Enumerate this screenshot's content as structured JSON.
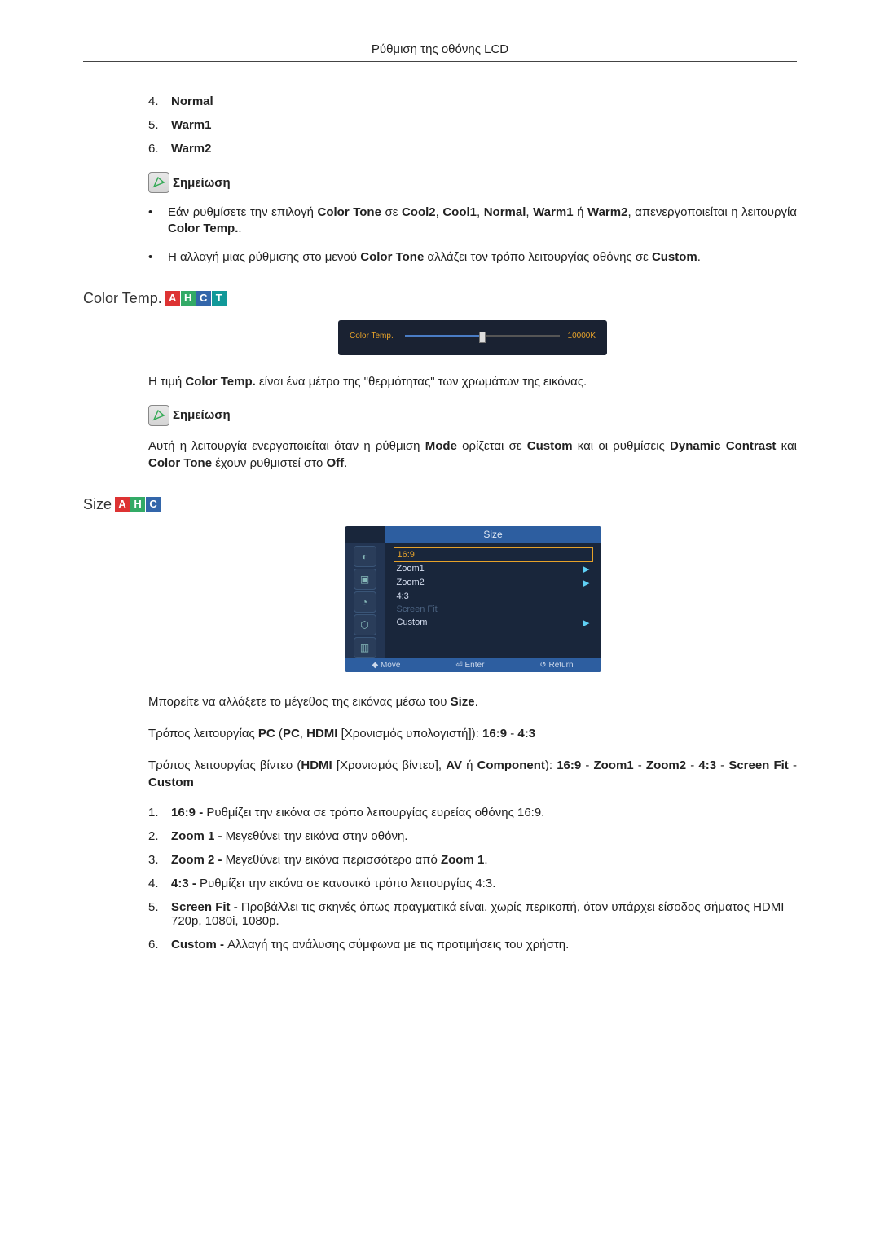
{
  "header": {
    "title": "Ρύθμιση της οθόνης LCD"
  },
  "top_list": {
    "items": [
      {
        "num": "4.",
        "label": "Normal"
      },
      {
        "num": "5.",
        "label": "Warm1"
      },
      {
        "num": "6.",
        "label": "Warm2"
      }
    ]
  },
  "note_label": "Σημείωση",
  "note1": {
    "bullets": [
      "Εάν ρυθμίσετε την επιλογή Color Tone σε Cool2, Cool1, Normal, Warm1 ή Warm2, απενεργοποιείται η λειτουργία Color Temp..",
      "Η αλλαγή μιας ρύθμισης στο μενού Color Tone αλλάζει τον τρόπο λειτουργίας οθόνης σε Custom."
    ]
  },
  "color_temp": {
    "title": "Color Temp.",
    "slider_label": "Color Temp.",
    "slider_value": "10000K",
    "para": "Η τιμή Color Temp. είναι ένα μέτρο της \"θερμότητας\" των χρωμάτων της εικόνας.",
    "note_body": "Αυτή η λειτουργία ενεργοποιείται όταν η ρύθμιση Mode ορίζεται σε Custom και οι ρυθμίσεις Dynamic Contrast και Color Tone έχουν ρυθμιστεί στο Off."
  },
  "size": {
    "title": "Size",
    "menu_title": "Size",
    "menu_items": [
      {
        "label": "16:9",
        "selected": true
      },
      {
        "label": "Zoom1",
        "arrow": true
      },
      {
        "label": "Zoom2",
        "arrow": true
      },
      {
        "label": "4:3"
      },
      {
        "label": "Screen Fit",
        "disabled": true
      },
      {
        "label": "Custom",
        "arrow": true
      }
    ],
    "footer": {
      "move": "Move",
      "enter": "Enter",
      "return": "Return"
    },
    "para1": "Μπορείτε να αλλάξετε το μέγεθος της εικόνας μέσω του Size.",
    "para2": "Τρόπος λειτουργίας PC (PC, HDMI [Χρονισμός υπολογιστή]): 16:9 - 4:3",
    "para3": "Τρόπος λειτουργίας βίντεο (HDMI [Χρονισμός βίντεο], AV ή Component): 16:9 - Zoom1 - Zoom2 - 4:3 - Screen Fit - Custom",
    "list": [
      {
        "num": "1.",
        "text": "16:9 - Ρυθμίζει την εικόνα σε τρόπο λειτουργίας ευρείας οθόνης 16:9."
      },
      {
        "num": "2.",
        "text": "Zoom 1 - Μεγεθύνει την εικόνα στην οθόνη."
      },
      {
        "num": "3.",
        "text": "Zoom 2 - Μεγεθύνει την εικόνα περισσότερο από Zoom 1."
      },
      {
        "num": "4.",
        "text": "4:3 - Ρυθμίζει την εικόνα σε κανονικό τρόπο λειτουργίας 4:3."
      },
      {
        "num": "5.",
        "text": "Screen Fit - Προβάλλει τις σκηνές όπως πραγματικά είναι, χωρίς περικοπή, όταν υπάρχει είσοδος σήματος HDMI 720p, 1080i, 1080p."
      },
      {
        "num": "6.",
        "text": "Custom - Αλλαγή της ανάλυσης σύμφωνα με τις προτιμήσεις του χρήστη."
      }
    ]
  }
}
